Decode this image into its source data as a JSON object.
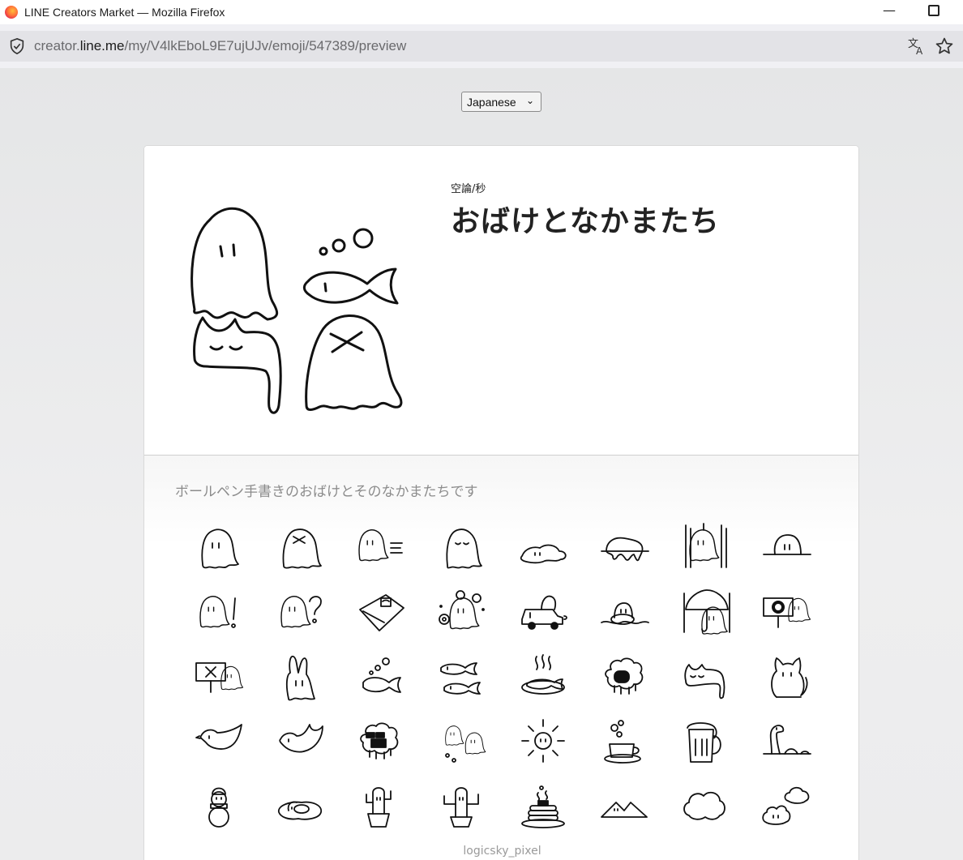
{
  "window": {
    "title": "LINE Creators Market — Mozilla Firefox"
  },
  "urlbar": {
    "url_prefix": "creator.",
    "url_domain": "line.me",
    "url_path": "/my/V4lkEboL9E7ujUJv/emoji/547389/preview"
  },
  "language_select": {
    "value": "Japanese"
  },
  "pack": {
    "author": "空論/秒",
    "title": "おばけとなかまたち",
    "description": "ボールペン手書きのおばけとそのなかまたちです",
    "footer": "logicsky_pixel"
  },
  "emoji_rows": [
    [
      "ghost",
      "ghost-x",
      "ghost-dash",
      "ghost-sleepy",
      "puddle",
      "melting",
      "ghost-rain",
      "ghost-peek"
    ],
    [
      "ghost-exclaim",
      "ghost-question",
      "bed",
      "ghost-flowers",
      "car",
      "ghost-float",
      "umbrella",
      "sign-o"
    ],
    [
      "sign-x",
      "bunny-ghost",
      "fish-bubbles",
      "two-fish",
      "grilled-fish",
      "sheep",
      "cat-lying",
      "cat-sitting"
    ],
    [
      "bird",
      "bird-flying",
      "sheep-sunglasses",
      "ghost-pair",
      "sun",
      "coffee",
      "beer",
      "nessie"
    ],
    [
      "snowman",
      "fried-egg",
      "cactus",
      "cactus-arms",
      "pancakes",
      "mountains",
      "cloud",
      "cloud-ghosts"
    ]
  ]
}
